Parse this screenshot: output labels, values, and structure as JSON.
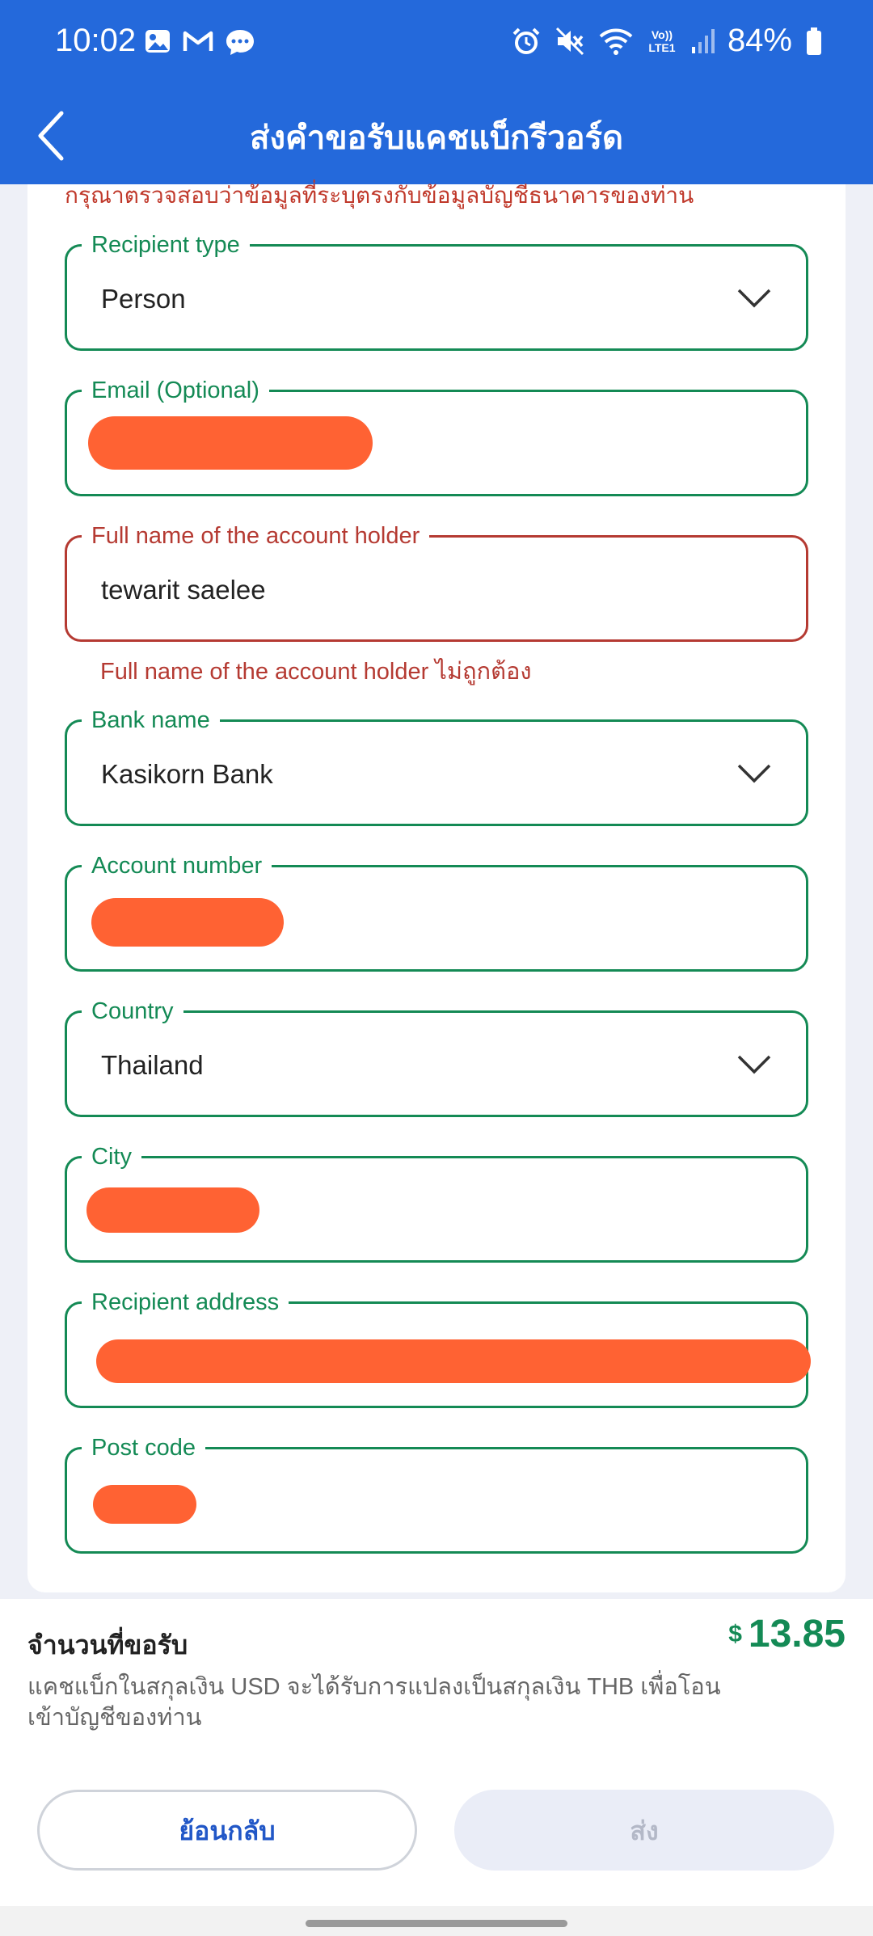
{
  "status_bar": {
    "time": "10:02",
    "battery": "84%",
    "network_label": "Vo)) LTE1",
    "left_icons": [
      "gallery-icon",
      "gmail-icon",
      "chat-icon"
    ],
    "right_icons": [
      "alarm-icon",
      "mute-icon",
      "wifi-icon",
      "signal-icon",
      "battery-icon"
    ]
  },
  "header": {
    "title": "ส่งคำขอรับแคชแบ็กรีวอร์ด"
  },
  "form": {
    "notice": "กรุณาตรวจสอบว่าข้อมูลที่ระบุตรงกับข้อมูลบัญชีธนาคารของท่าน",
    "recipient_type": {
      "label": "Recipient type",
      "value": "Person"
    },
    "email": {
      "label": "Email (Optional)"
    },
    "full_name": {
      "label": "Full name of the account holder",
      "value": "tewarit saelee",
      "error": "Full name of the account holder ไม่ถูกต้อง"
    },
    "bank_name": {
      "label": "Bank name",
      "value": "Kasikorn Bank"
    },
    "account_number": {
      "label": "Account number"
    },
    "country": {
      "label": "Country",
      "value": "Thailand"
    },
    "city": {
      "label": "City"
    },
    "recipient_address": {
      "label": "Recipient address"
    },
    "post_code": {
      "label": "Post code"
    }
  },
  "footer": {
    "amount_label": "จำนวนที่ขอรับ",
    "currency_symbol": "$",
    "amount": "13.85",
    "description": "แคชแบ็กในสกุลเงิน USD จะได้รับการแปลงเป็นสกุลเงิน THB เพื่อโอนเข้าบัญชีของท่าน",
    "back_button": "ย้อนกลับ",
    "send_button": "ส่ง"
  },
  "colors": {
    "header_blue": "#2469db",
    "field_green": "#148a55",
    "error_red": "#b53a32",
    "redaction_orange": "#ff6233"
  }
}
